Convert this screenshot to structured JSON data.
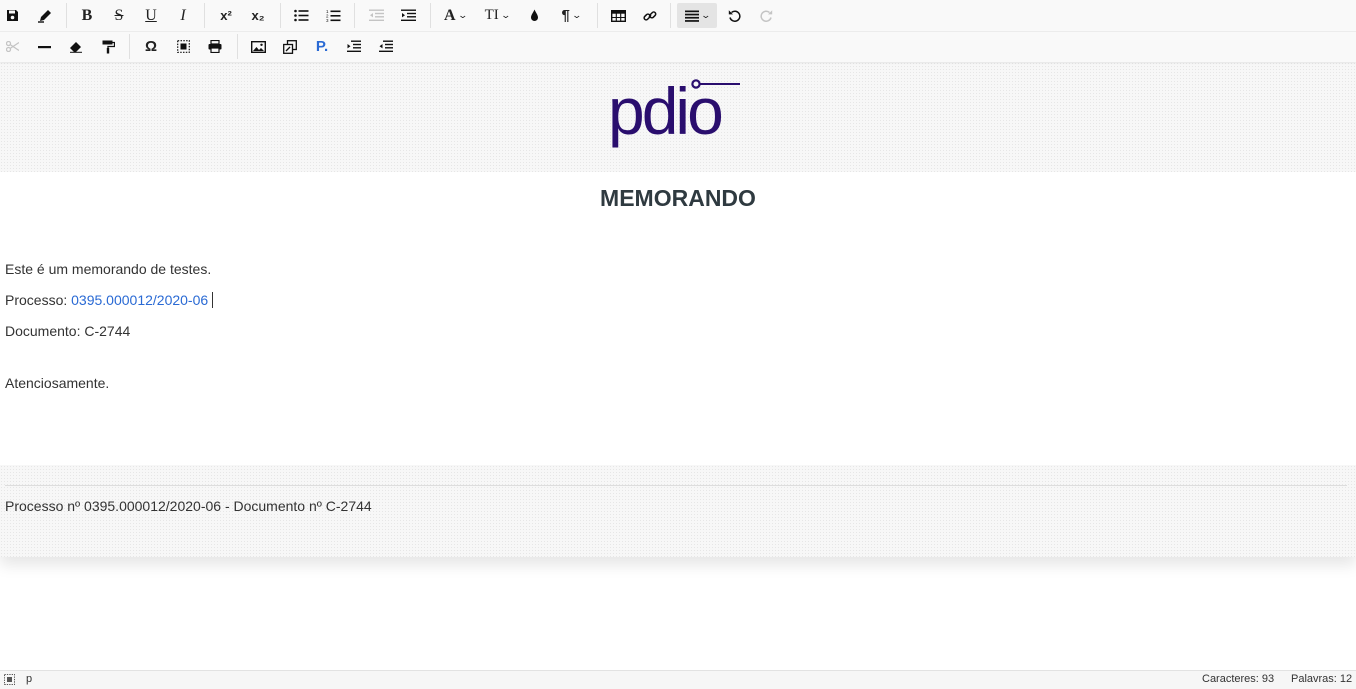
{
  "toolbar": {
    "row1": [
      {
        "name": "save-icon"
      },
      {
        "name": "edit-pen-icon"
      },
      {
        "name": "bold-button",
        "label": "B"
      },
      {
        "name": "strikethrough-button",
        "label": "S"
      },
      {
        "name": "underline-button",
        "label": "U"
      },
      {
        "name": "italic-button",
        "label": "I"
      },
      {
        "name": "superscript-button",
        "label": "x²"
      },
      {
        "name": "subscript-button",
        "label": "x₂"
      },
      {
        "name": "bulleted-list-icon"
      },
      {
        "name": "numbered-list-icon"
      },
      {
        "name": "outdent-icon",
        "state": "disabled"
      },
      {
        "name": "indent-icon"
      },
      {
        "name": "font-family-dropdown",
        "label": "A"
      },
      {
        "name": "font-size-dropdown",
        "label": "TI"
      },
      {
        "name": "text-color-drop-icon"
      },
      {
        "name": "paragraph-format-dropdown",
        "label": "¶"
      },
      {
        "name": "table-icon"
      },
      {
        "name": "link-icon"
      },
      {
        "name": "align-dropdown",
        "state": "active"
      },
      {
        "name": "undo-icon"
      },
      {
        "name": "redo-icon",
        "state": "disabled"
      }
    ],
    "row2": [
      {
        "name": "cut-icon",
        "state": "disabled"
      },
      {
        "name": "horizontal-line-icon"
      },
      {
        "name": "eraser-icon"
      },
      {
        "name": "format-painter-icon"
      },
      {
        "name": "special-character-button",
        "label": "Ω"
      },
      {
        "name": "select-all-icon"
      },
      {
        "name": "print-icon"
      },
      {
        "name": "image-icon"
      },
      {
        "name": "copy-format-icon"
      },
      {
        "name": "process-link-button",
        "label": "P."
      },
      {
        "name": "line-indent-icon"
      },
      {
        "name": "line-outdent-icon"
      }
    ]
  },
  "document": {
    "logo_text": "pdio",
    "title": "MEMORANDO",
    "line1": "Este é um memorando de testes.",
    "line2_label": "Processo: ",
    "line2_link": "0395.000012/2020-06",
    "line3": "Documento: C-2744",
    "line4": "Atenciosamente.",
    "footer": "Processo nº 0395.000012/2020-06 - Documento nº C-2744"
  },
  "colors": {
    "logo": "#2a0e6e",
    "link": "#2a6ad4",
    "title": "#2f3a40"
  },
  "statusbar": {
    "element_path": "p",
    "chars": "Caracteres: 93",
    "words": "Palavras: 12"
  }
}
